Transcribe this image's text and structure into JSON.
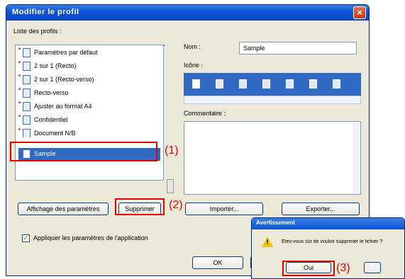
{
  "dialog": {
    "title": "Modifier le profil",
    "profiles_label": "Liste des profils :",
    "profiles": [
      {
        "name": "Paramètres par défaut"
      },
      {
        "name": "2 sur 1 (Recto)"
      },
      {
        "name": "2 sur 1 (Recto-verso)"
      },
      {
        "name": "Recto-verso"
      },
      {
        "name": "Ajuster au format A4"
      },
      {
        "name": "Confidentiel"
      },
      {
        "name": "Document N/B"
      },
      {
        "name": "Sample"
      }
    ],
    "selected_profile": "Sample",
    "nom_label": "Nom :",
    "nom_value": "Sample",
    "icone_label": "Icône :",
    "comment_label": "Commentaire :",
    "comment_value": "",
    "buttons": {
      "display_settings": "Affichage des paramètres",
      "delete": "Supprimer",
      "import": "Importer...",
      "export": "Exporter...",
      "ok": "OK"
    },
    "apply_checkbox_label": "Appliquer les paramètres de l'application",
    "apply_checked": true
  },
  "callouts": {
    "one": "(1)",
    "two": "(2)",
    "three": "(3)"
  },
  "warning": {
    "title": "Avertissement",
    "message": "Êtes-vous sûr de vouloir supprimer le fichier ?",
    "yes": "Oui"
  },
  "colors": {
    "selection": "#316ac5",
    "callout": "#e00000",
    "titlebar": "#0a54d6"
  }
}
